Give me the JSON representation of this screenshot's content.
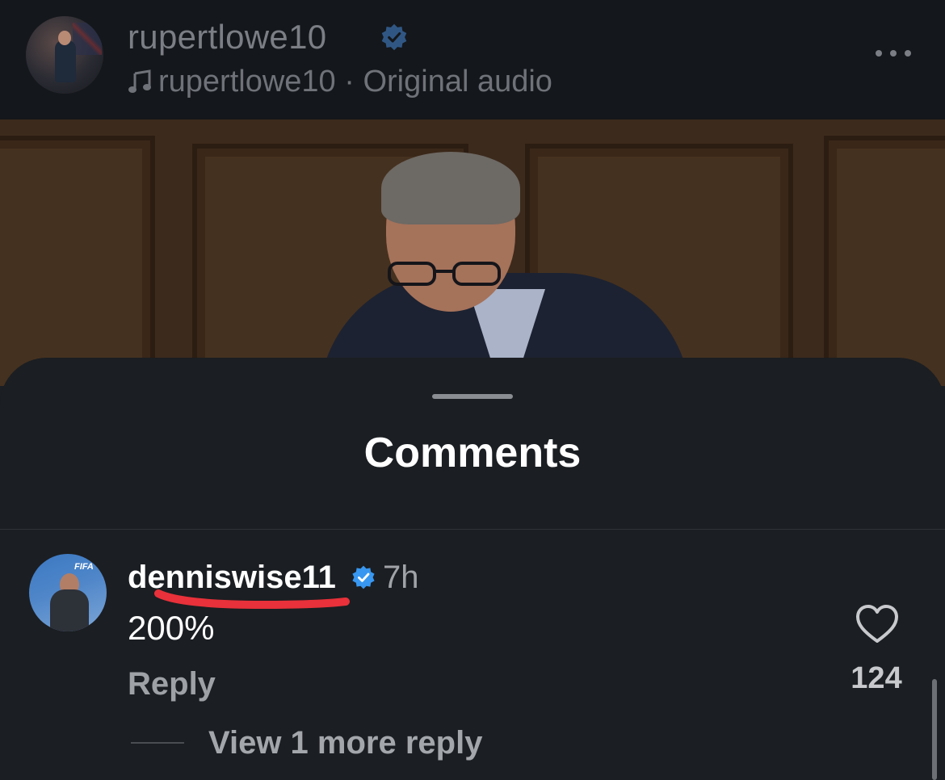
{
  "header": {
    "username": "rupertlowe10",
    "audio_text": "rupertlowe10 · Original audio",
    "icons": {
      "verified": "verified-badge-icon",
      "music": "music-note-icon",
      "more": "more-options-icon"
    }
  },
  "sheet": {
    "title": "Comments"
  },
  "comment": {
    "username": "denniswise11",
    "time": "7h",
    "text": "200%",
    "reply_label": "Reply",
    "like_count": "124",
    "view_replies_label": "View 1 more reply"
  },
  "colors": {
    "background": "#1b1e22",
    "header": "#14171b",
    "verified_blue": "#3897f0",
    "annotation_red": "#e8313a"
  }
}
